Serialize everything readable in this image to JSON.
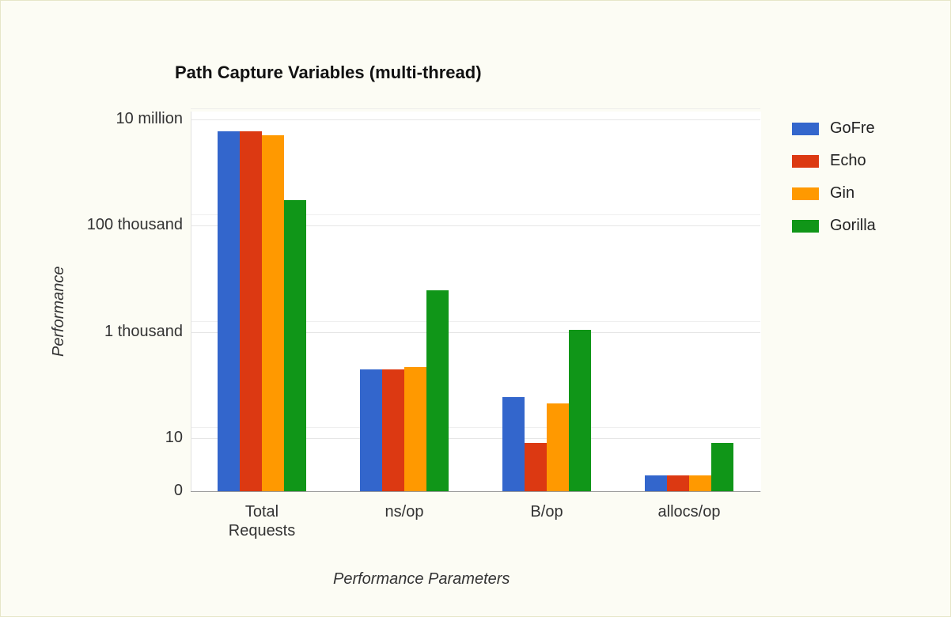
{
  "chart_data": {
    "type": "bar",
    "title": "Path Capture Variables (multi-thread)",
    "xlabel": "Performance Parameters",
    "ylabel": "Performance",
    "categories": [
      "Total Requests",
      "ns/op",
      "B/op",
      "allocs/op"
    ],
    "series": [
      {
        "name": "GoFre",
        "color": "#3366cc",
        "values": [
          6000000,
          200,
          60,
          2
        ]
      },
      {
        "name": "Echo",
        "color": "#dc3912",
        "values": [
          6000000,
          200,
          8,
          2
        ]
      },
      {
        "name": "Gin",
        "color": "#ff9900",
        "values": [
          5000000,
          220,
          45,
          2
        ]
      },
      {
        "name": "Gorilla",
        "color": "#109618",
        "values": [
          300000,
          6000,
          1100,
          8
        ]
      }
    ],
    "y_ticks": [
      {
        "label": "0",
        "value": 0
      },
      {
        "label": "10",
        "value": 10
      },
      {
        "label": "1 thousand",
        "value": 1000
      },
      {
        "label": "100 thousand",
        "value": 100000
      },
      {
        "label": "10 million",
        "value": 10000000
      }
    ],
    "y_scale": "log",
    "legend_position": "right"
  }
}
